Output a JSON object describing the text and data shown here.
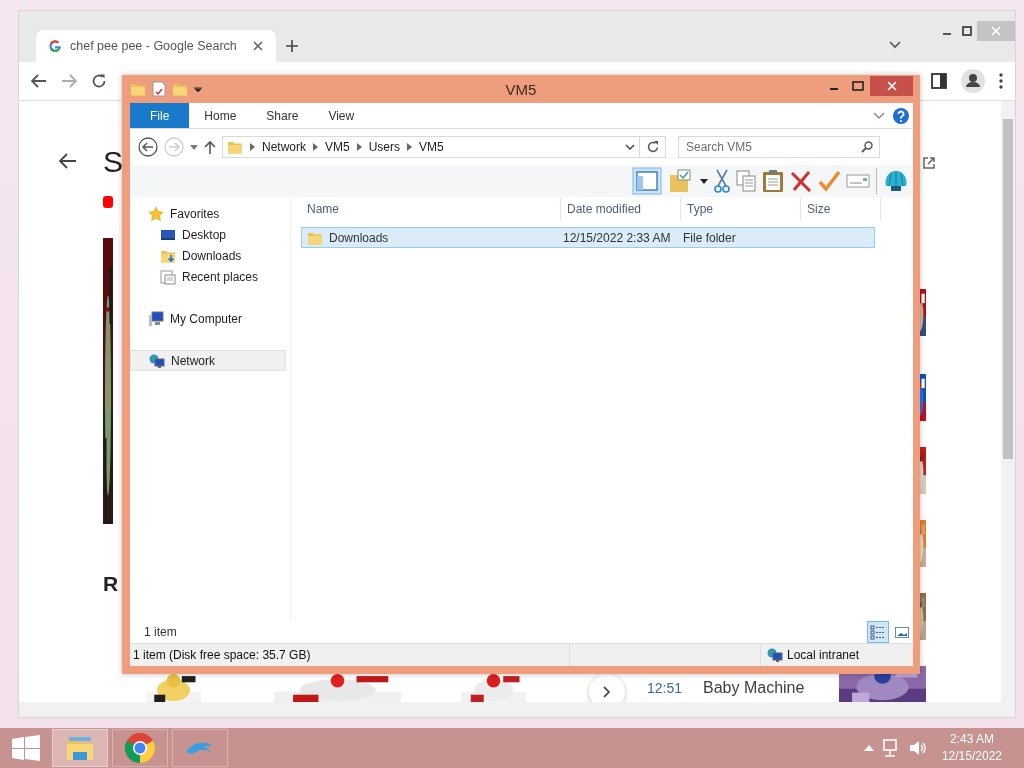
{
  "browser": {
    "tab": {
      "title": "chef pee pee - Google Search",
      "selected": true
    },
    "page": {
      "heading": "S",
      "section_heading": "R",
      "video": {
        "time": "12:51",
        "title": "Baby Machine"
      }
    }
  },
  "explorer": {
    "title": "VM5",
    "ribbon_tabs": [
      {
        "label": "File",
        "kind": "menu"
      },
      {
        "label": "Home",
        "kind": "tab"
      },
      {
        "label": "Share",
        "kind": "tab"
      },
      {
        "label": "View",
        "kind": "tab"
      }
    ],
    "breadcrumb": [
      "Network",
      "VM5",
      "Users",
      "VM5"
    ],
    "search": {
      "placeholder": "Search VM5"
    },
    "nav": [
      {
        "label": "Favorites",
        "kind": "favorites",
        "selected": false,
        "children": [
          {
            "label": "Desktop",
            "kind": "desktop",
            "selected": false
          },
          {
            "label": "Downloads",
            "kind": "downloads",
            "selected": false
          },
          {
            "label": "Recent places",
            "kind": "recent",
            "selected": false
          }
        ]
      },
      {
        "label": "My Computer",
        "kind": "computer",
        "selected": false
      },
      {
        "label": "Network",
        "kind": "network",
        "selected": true
      }
    ],
    "columns": [
      "Name",
      "Date modified",
      "Type",
      "Size"
    ],
    "rows": [
      {
        "name": "Downloads",
        "date_modified": "12/15/2022 2:33 AM",
        "type": "File folder",
        "selected": true
      }
    ],
    "item_count": "1 item",
    "view_buttons": [
      {
        "kind": "details",
        "selected": true
      },
      {
        "kind": "thumbnails",
        "selected": false
      }
    ],
    "status_bar": {
      "text": "1 item (Disk free space: 35.7 GB)",
      "zone": "Local intranet"
    }
  },
  "taskbar": {
    "apps": [
      {
        "kind": "explorer",
        "selected": true
      },
      {
        "kind": "chrome",
        "selected": false
      },
      {
        "kind": "dolphin",
        "selected": false
      }
    ],
    "time": "2:43 AM",
    "date": "12/15/2022"
  }
}
